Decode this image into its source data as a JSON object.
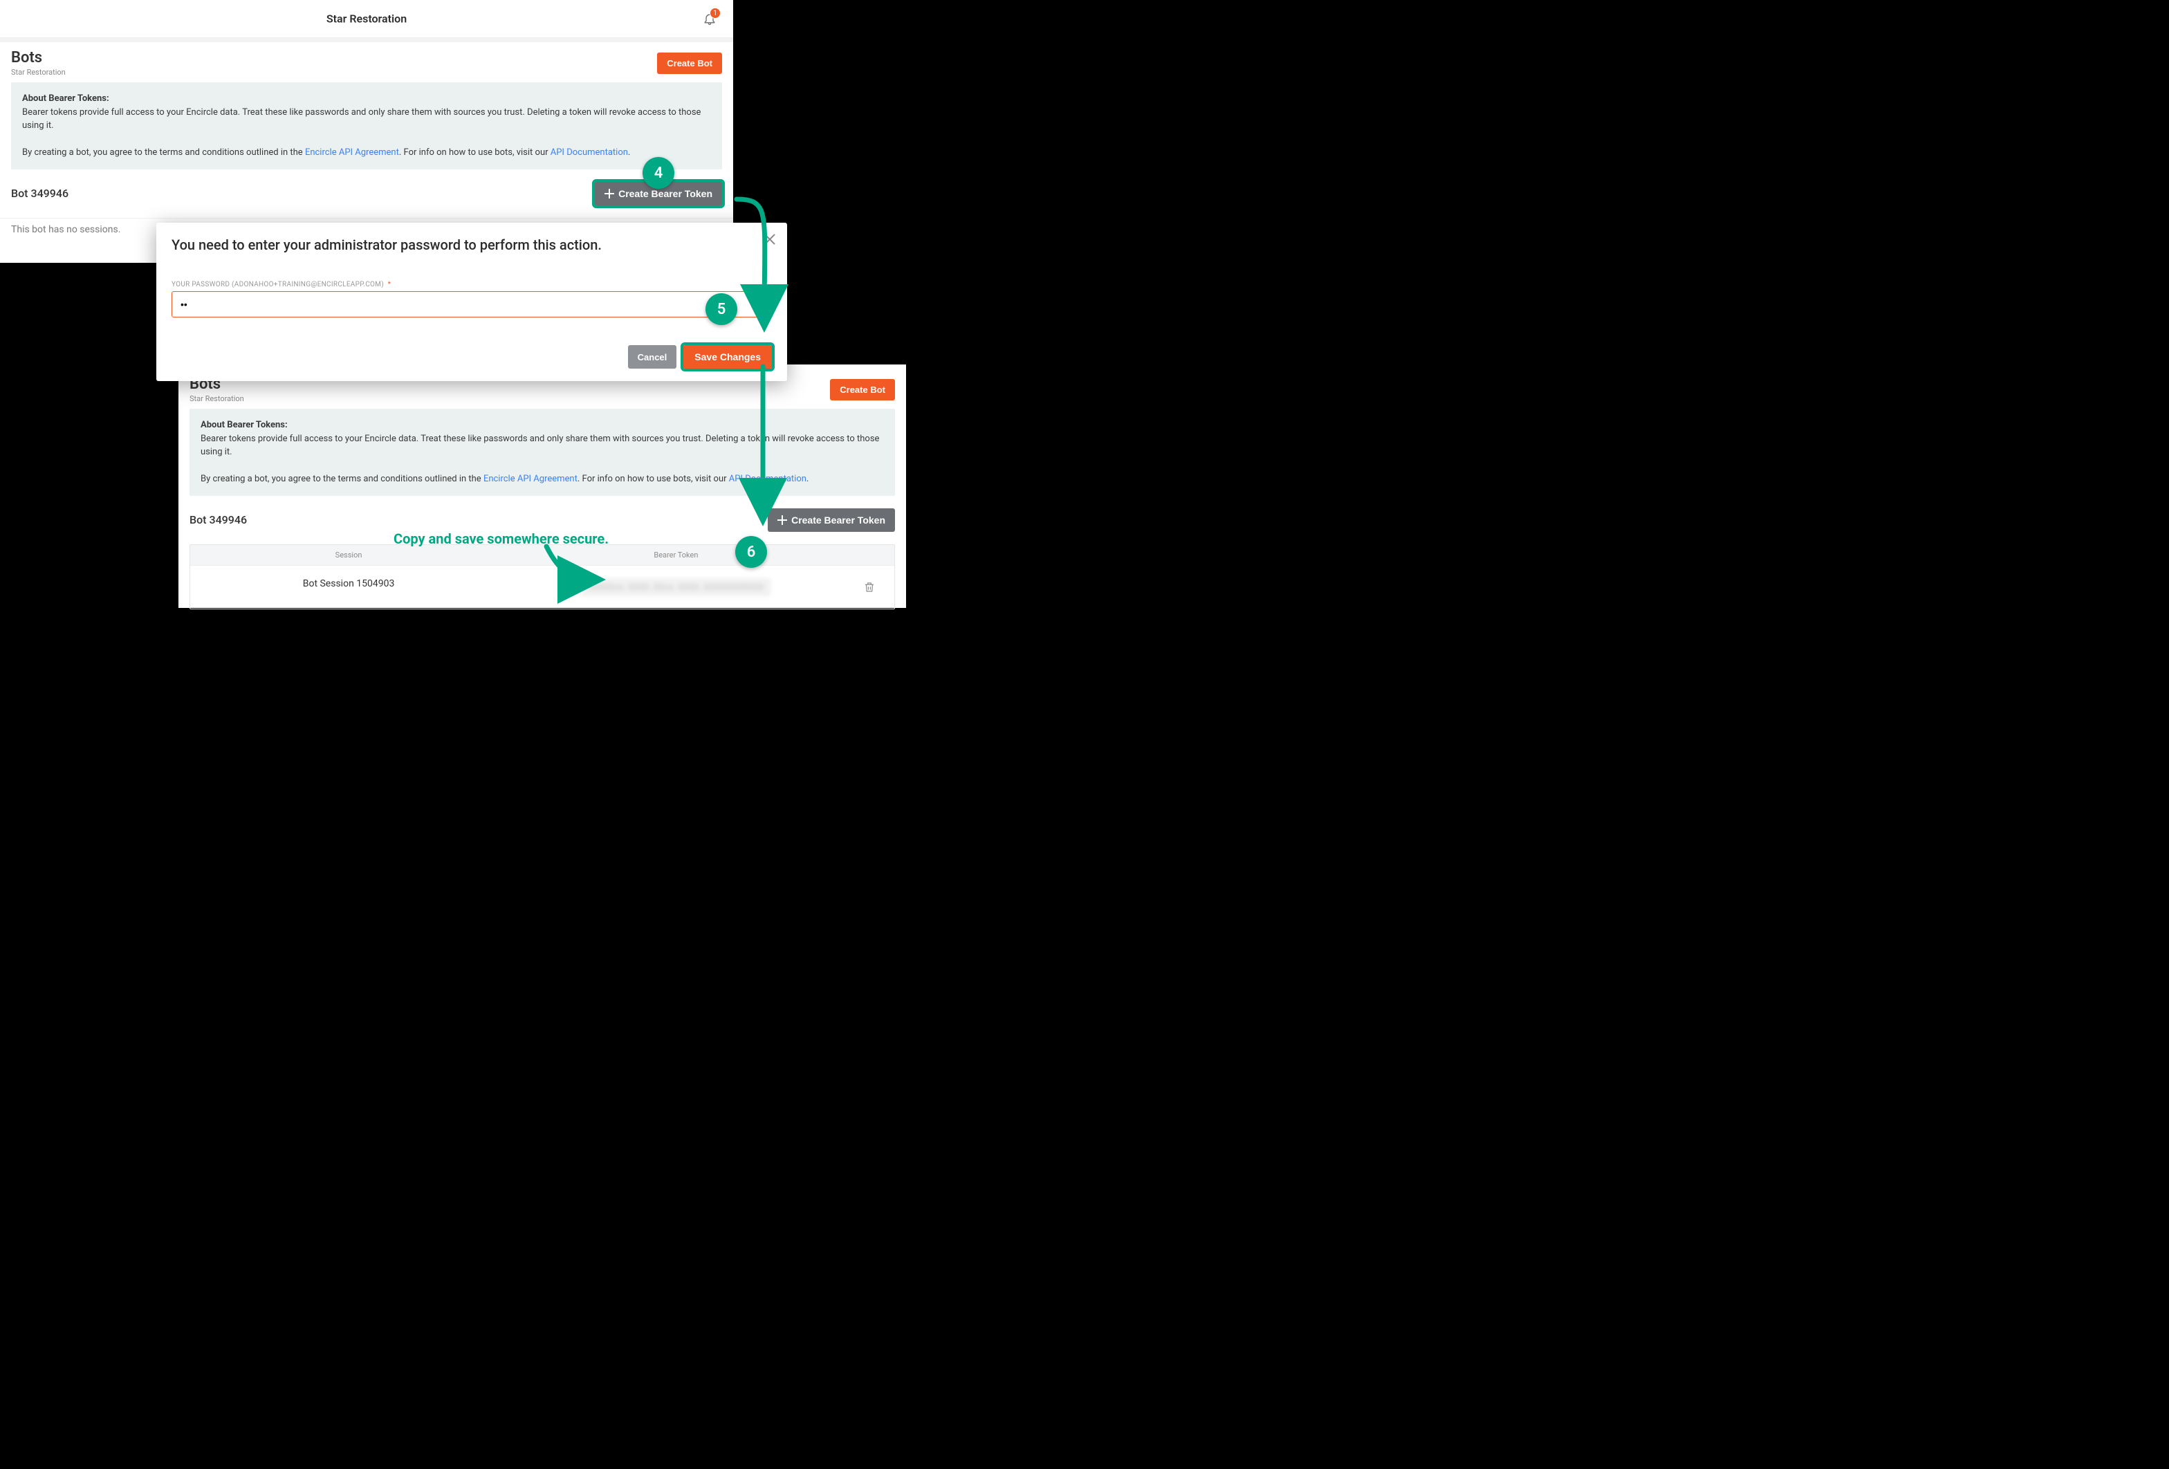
{
  "colors": {
    "accent": "#f15a24",
    "teal": "#00a884",
    "link": "#3b82f6"
  },
  "topbar": {
    "title": "Star Restoration",
    "bell_badge": "1"
  },
  "page1": {
    "heading": "Bots",
    "org": "Star Restoration",
    "create_bot": "Create Bot",
    "info": {
      "heading": "About Bearer Tokens:",
      "body": "Bearer tokens provide full access to your Encircle data. Treat these like passwords and only share them with sources you trust. Deleting a token will revoke access to those using it.",
      "agree_pre": "By creating a bot, you agree to the terms and conditions outlined in the ",
      "agree_link": "Encircle API Agreement",
      "agree_mid": ". For info on how to use bots, visit our ",
      "docs_link": "API Documentation",
      "agree_post": "."
    },
    "bot_name": "Bot 349946",
    "create_token": "Create Bearer Token",
    "no_sessions": "This bot has no sessions."
  },
  "modal": {
    "title": "You need to enter your administrator password to perform this action.",
    "label": "YOUR PASSWORD (ADONAHOO+TRAINING@ENCIRCLEAPP.COM)",
    "required": "*",
    "value": "••",
    "cancel": "Cancel",
    "save": "Save Changes"
  },
  "page3": {
    "heading": "Bots",
    "org": "Star Restoration",
    "create_bot": "Create Bot",
    "bot_name": "Bot 349946",
    "create_token": "Create Bearer Token",
    "table": {
      "col_session": "Session",
      "col_token": "Bearer Token",
      "session_name": "Bot Session 1504903",
      "token_preview": "XXXXXxx-XXXX-XXxx-XXXX-XXXXXXXXXXXX"
    }
  },
  "steps": {
    "s4": "4",
    "s5": "5",
    "s6": "6"
  },
  "note_copy": "Copy and save somewhere secure."
}
